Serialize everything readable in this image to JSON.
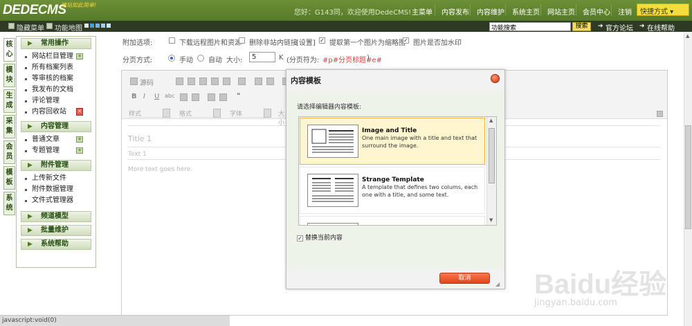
{
  "topbar": {
    "logo_main": "DEDE",
    "logo_cms": "CMS",
    "slogan": "建站如此简单!",
    "greeting": "您好：G143同，欢迎使用DedeCMS!",
    "nav": [
      "主菜单",
      "内容发布",
      "内容维护",
      "系统主页",
      "网站主页",
      "会员中心",
      "注销"
    ],
    "quick_menu": "快捷方式 ▾"
  },
  "subbar": {
    "hide_menu": "隐藏菜单",
    "site_map": "功能地图",
    "search_value": "功能搜索",
    "search_button": "搜索",
    "forum": "官方论坛",
    "help": "在线帮助"
  },
  "vtabs": [
    "核心",
    "模块",
    "生成",
    "采集",
    "会员",
    "模板",
    "系统"
  ],
  "menu": {
    "sections": [
      {
        "title": "常用操作",
        "items": [
          "网站栏目管理",
          "所有档案列表",
          "等审核的档案",
          "我发布的文档",
          "评论管理",
          "内容回收站"
        ]
      },
      {
        "title": "内容管理",
        "items": [
          "普通文章",
          "专题管理"
        ]
      },
      {
        "title": "附件管理",
        "items": [
          "上传新文件",
          "附件数据管理",
          "文件式管理器"
        ]
      },
      {
        "title": "频道模型",
        "items": []
      },
      {
        "title": "批量维护",
        "items": []
      },
      {
        "title": "系统帮助",
        "items": []
      }
    ]
  },
  "form": {
    "extra_label": "附加选项:",
    "opt_download": "下载远程图片和资源",
    "opt_remove_links": "删除非站内链接",
    "opt_settings": "[设置]",
    "opt_thumb": "提取第一个图片为缩略图",
    "opt_watermark": "图片是否加水印",
    "page_label": "分页方式:",
    "manual": "手动",
    "auto": "自动",
    "size_label": "大小:",
    "size_value": "5",
    "size_unit": "K",
    "page_sep_label": "(分页符为:",
    "page_sep": "#p#分页标题#e#",
    "page_sep_close": ")"
  },
  "editor": {
    "source": "源码",
    "styles": [
      "样式",
      "格式",
      "字体",
      "大小"
    ],
    "title_placeholder": "Title 1",
    "text_placeholder": "Text 1",
    "more_text": "More text goes here."
  },
  "dialog": {
    "title": "内容模板",
    "prompt": "请选择编辑器内容模板:",
    "templates": [
      {
        "name": "Image and Title",
        "desc": "One main image with a title and text that surround the image."
      },
      {
        "name": "Strange Template",
        "desc": "A template that defines two colums, each one with a title, and some text."
      }
    ],
    "replace_label": "替换当前内容",
    "cancel": "取消"
  },
  "status": "javascript:void(0)",
  "watermark": {
    "brand": "Baidu经验",
    "url": "jingyan.baidu.com"
  }
}
